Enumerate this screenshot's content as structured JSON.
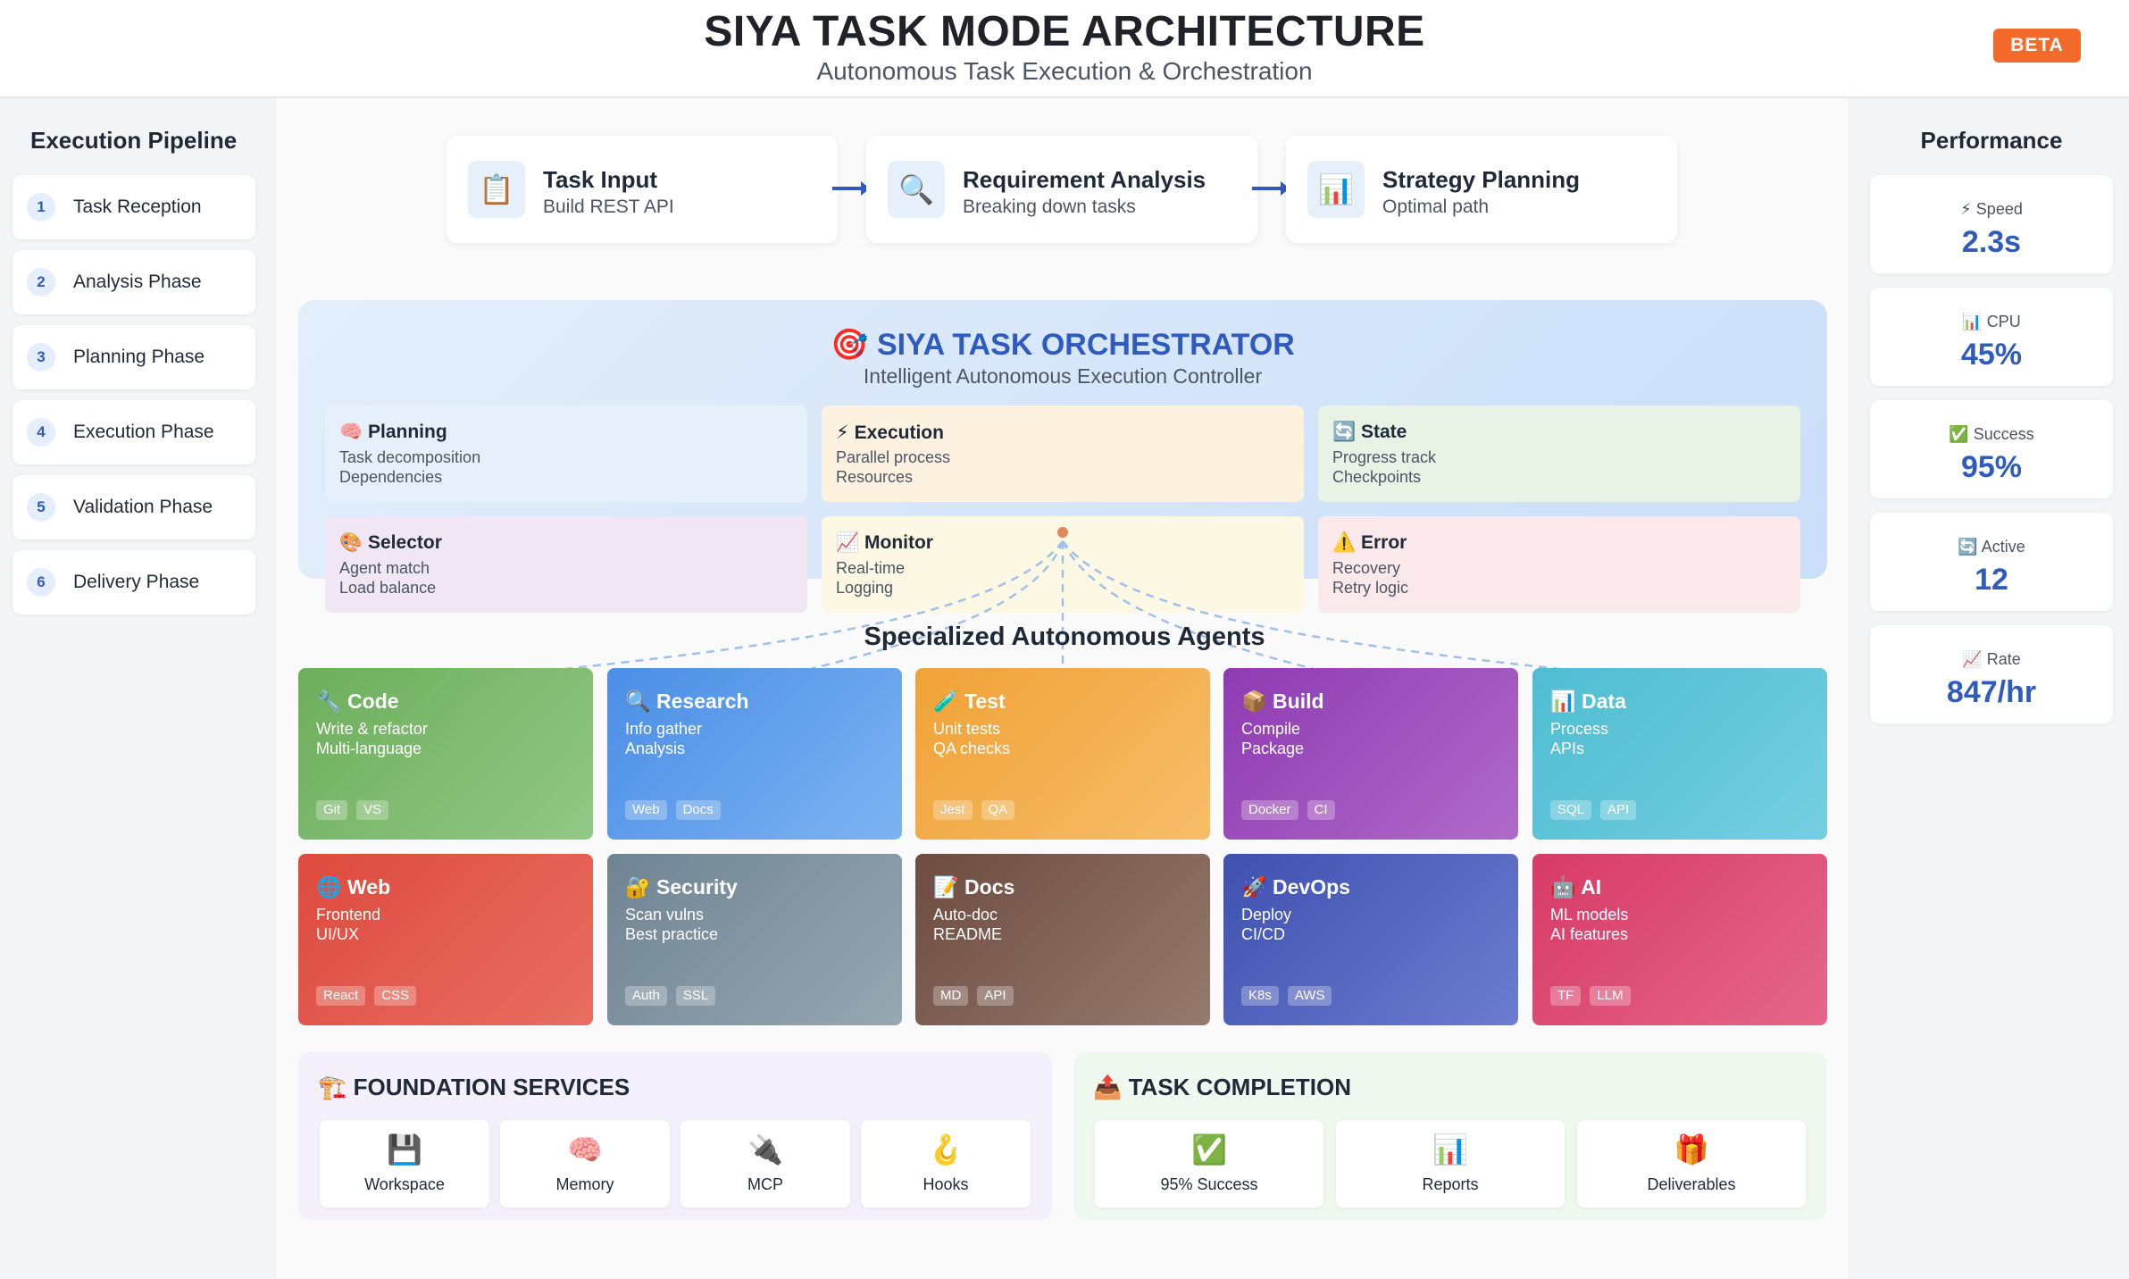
{
  "header": {
    "title": "SIYA TASK MODE ARCHITECTURE",
    "subtitle": "Autonomous Task Execution & Orchestration",
    "badge": "BETA"
  },
  "pipeline": {
    "title": "Execution Pipeline",
    "items": [
      {
        "num": "1",
        "label": "Task Reception"
      },
      {
        "num": "2",
        "label": "Analysis Phase"
      },
      {
        "num": "3",
        "label": "Planning Phase"
      },
      {
        "num": "4",
        "label": "Execution Phase"
      },
      {
        "num": "5",
        "label": "Validation Phase"
      },
      {
        "num": "6",
        "label": "Delivery Phase"
      }
    ]
  },
  "performance": {
    "title": "Performance",
    "items": [
      {
        "icon": "⚡",
        "label": "Speed",
        "value": "2.3s"
      },
      {
        "icon": "📊",
        "label": "CPU",
        "value": "45%"
      },
      {
        "icon": "✅",
        "label": "Success",
        "value": "95%"
      },
      {
        "icon": "🔄",
        "label": "Active",
        "value": "12"
      },
      {
        "icon": "📈",
        "label": "Rate",
        "value": "847/hr"
      }
    ]
  },
  "flow": [
    {
      "icon": "📋",
      "title": "Task Input",
      "sub": "Build REST API"
    },
    {
      "icon": "🔍",
      "title": "Requirement Analysis",
      "sub": "Breaking down tasks"
    },
    {
      "icon": "📊",
      "title": "Strategy Planning",
      "sub": "Optimal path"
    }
  ],
  "orchestrator": {
    "icon": "🎯",
    "title": "SIYA TASK ORCHESTRATOR",
    "subtitle": "Intelligent Autonomous Execution Controller",
    "modules": [
      {
        "icon": "🧠",
        "title": "Planning",
        "l1": "Task decomposition",
        "l2": "Dependencies",
        "color": "#e6f0fb"
      },
      {
        "icon": "⚡",
        "title": "Execution",
        "l1": "Parallel process",
        "l2": "Resources",
        "color": "#fdf1e0"
      },
      {
        "icon": "🔄",
        "title": "State",
        "l1": "Progress track",
        "l2": "Checkpoints",
        "color": "#e8f3e6"
      },
      {
        "icon": "🎨",
        "title": "Selector",
        "l1": "Agent match",
        "l2": "Load balance",
        "color": "#f1e6f4"
      },
      {
        "icon": "📈",
        "title": "Monitor",
        "l1": "Real-time",
        "l2": "Logging",
        "color": "#fdf8e4"
      },
      {
        "icon": "⚠️",
        "title": "Error",
        "l1": "Recovery",
        "l2": "Retry logic",
        "color": "#fbe8ea"
      }
    ]
  },
  "agents": {
    "title": "Specialized Autonomous Agents",
    "items": [
      {
        "icon": "🔧",
        "title": "Code",
        "l1": "Write & refactor",
        "l2": "Multi-language",
        "tags": [
          "Git",
          "VS"
        ],
        "c1": "#6cae5a",
        "c2": "#92c886"
      },
      {
        "icon": "🔍",
        "title": "Research",
        "l1": "Info gather",
        "l2": "Analysis",
        "tags": [
          "Web",
          "Docs"
        ],
        "c1": "#4a8ee6",
        "c2": "#7db3f2"
      },
      {
        "icon": "🧪",
        "title": "Test",
        "l1": "Unit tests",
        "l2": "QA checks",
        "tags": [
          "Jest",
          "QA"
        ],
        "c1": "#f0a236",
        "c2": "#f6bd6a"
      },
      {
        "icon": "📦",
        "title": "Build",
        "l1": "Compile",
        "l2": "Package",
        "tags": [
          "Docker",
          "CI"
        ],
        "c1": "#8e3bb2",
        "c2": "#b06ac8"
      },
      {
        "icon": "📊",
        "title": "Data",
        "l1": "Process",
        "l2": "APIs",
        "tags": [
          "SQL",
          "API"
        ],
        "c1": "#4fbcd2",
        "c2": "#74cfe0"
      },
      {
        "icon": "🌐",
        "title": "Web",
        "l1": "Frontend",
        "l2": "UI/UX",
        "tags": [
          "React",
          "CSS"
        ],
        "c1": "#de4a3e",
        "c2": "#e86e62"
      },
      {
        "icon": "🔐",
        "title": "Security",
        "l1": "Scan vulns",
        "l2": "Best practice",
        "tags": [
          "Auth",
          "SSL"
        ],
        "c1": "#6f8493",
        "c2": "#97a7b2"
      },
      {
        "icon": "📝",
        "title": "Docs",
        "l1": "Auto-doc",
        "l2": "README",
        "tags": [
          "MD",
          "API"
        ],
        "c1": "#6e4c40",
        "c2": "#957a6e"
      },
      {
        "icon": "🚀",
        "title": "DevOps",
        "l1": "Deploy",
        "l2": "CI/CD",
        "tags": [
          "K8s",
          "AWS"
        ],
        "c1": "#3f51b0",
        "c2": "#6c7cd0"
      },
      {
        "icon": "🤖",
        "title": "AI",
        "l1": "ML models",
        "l2": "AI features",
        "tags": [
          "TF",
          "LLM"
        ],
        "c1": "#d73a66",
        "c2": "#e5678b"
      }
    ]
  },
  "foundation": {
    "icon": "🏗️",
    "title": "FOUNDATION SERVICES",
    "items": [
      {
        "icon": "💾",
        "label": "Workspace"
      },
      {
        "icon": "🧠",
        "label": "Memory"
      },
      {
        "icon": "🔌",
        "label": "MCP"
      },
      {
        "icon": "🪝",
        "label": "Hooks"
      }
    ]
  },
  "completion": {
    "icon": "📤",
    "title": "TASK COMPLETION",
    "items": [
      {
        "icon": "✅",
        "label": "95% Success"
      },
      {
        "icon": "📊",
        "label": "Reports"
      },
      {
        "icon": "🎁",
        "label": "Deliverables"
      }
    ]
  },
  "colors": {
    "accent": "#2f5bbf",
    "beta": "#f26b2a",
    "connector": "#9fc0e8",
    "connector_dot": "#e0885a"
  }
}
